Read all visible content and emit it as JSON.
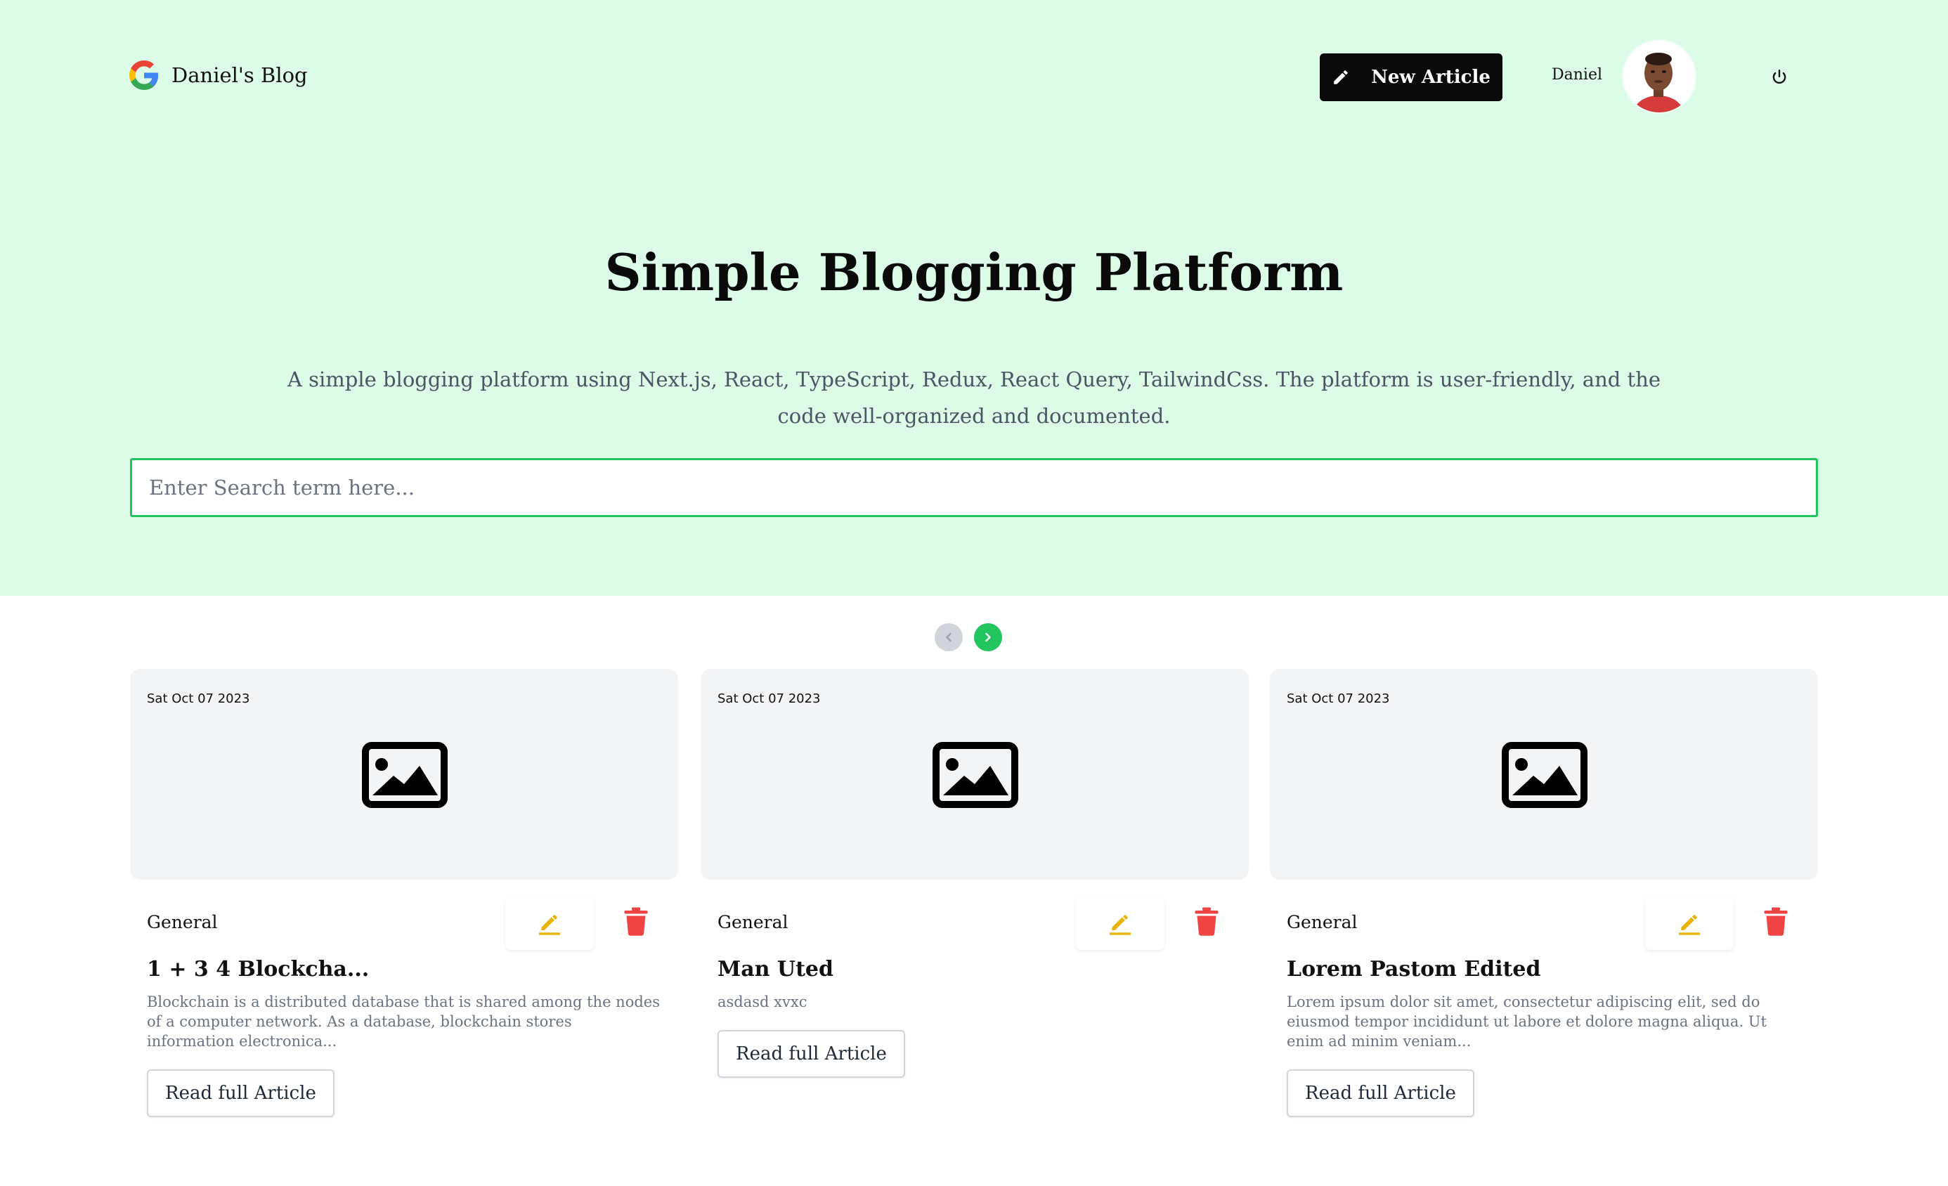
{
  "header": {
    "brand_name": "Daniel's Blog",
    "new_article_label": "New Article",
    "user_name": "Daniel"
  },
  "hero": {
    "title": "Simple Blogging Platform",
    "description": "A simple blogging platform using Next.js, React, TypeScript, Redux, React Query, TailwindCss. The platform is user-friendly, and the code well-organized and documented."
  },
  "search": {
    "placeholder": "Enter Search term here...",
    "value": ""
  },
  "pagination": {
    "prev_enabled": false,
    "next_enabled": true
  },
  "articles": [
    {
      "date": "Sat Oct 07 2023",
      "category": "General",
      "title": "1 + 3 4 Blockcha...",
      "excerpt": "Blockchain is a distributed database that is shared among the nodes of a computer network. As a database, blockchain stores information electronica...",
      "read_label": "Read full Article"
    },
    {
      "date": "Sat Oct 07 2023",
      "category": "General",
      "title": "Man Uted",
      "excerpt": "asdasd xvxc",
      "read_label": "Read full Article"
    },
    {
      "date": "Sat Oct 07 2023",
      "category": "General",
      "title": "Lorem Pastom Edited",
      "excerpt": "Lorem ipsum dolor sit amet, consectetur adipiscing elit, sed do eiusmod tempor incididunt ut labore et dolore magna aliqua. Ut enim ad minim veniam...",
      "read_label": "Read full Article"
    }
  ],
  "icons": {
    "brand": "google-logo-icon",
    "new_article": "pencil-icon",
    "logout": "power-icon",
    "pager_prev": "chevron-left-icon",
    "pager_next": "chevron-right-icon",
    "card_image": "image-placeholder-icon",
    "edit": "pencil-underline-icon",
    "delete": "trash-icon"
  },
  "colors": {
    "hero_bg": "#dcfce7",
    "accent_green": "#22c55e",
    "primary_button": "#0a0a0a",
    "edit_icon": "#eab308",
    "delete_icon": "#ef4444",
    "card_image_bg": "#f3f4f6"
  }
}
